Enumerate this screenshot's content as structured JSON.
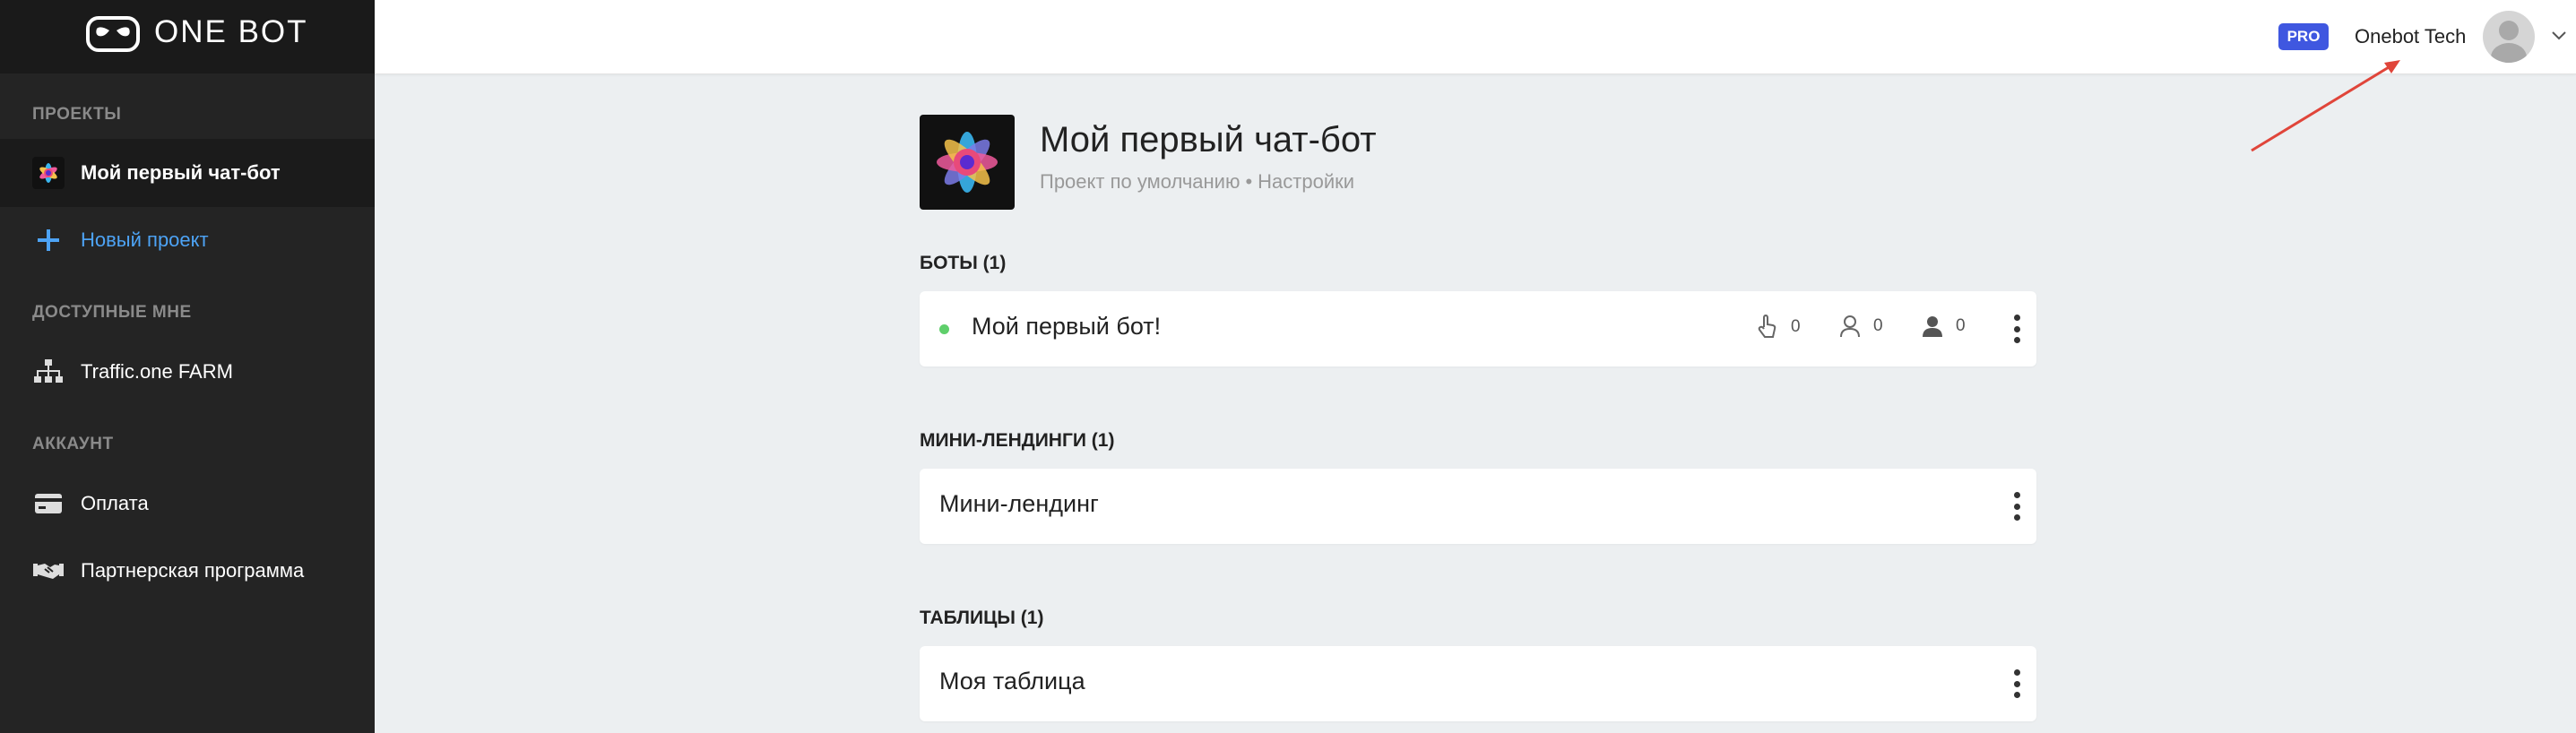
{
  "app": {
    "logo_text": "ONE BOT"
  },
  "sidebar": {
    "sections": [
      {
        "label": "ПРОЕКТЫ"
      },
      {
        "label": "ДОСТУПНЫЕ МНЕ"
      },
      {
        "label": "АККАУНТ"
      }
    ],
    "items": [
      {
        "label": "Мой первый чат-бот",
        "icon": "project-flower-icon",
        "active": true
      },
      {
        "label": "Новый проект",
        "icon": "plus-icon"
      },
      {
        "label": "Traffic.one FARM",
        "icon": "sitemap-icon"
      },
      {
        "label": "Оплата",
        "icon": "credit-card-icon"
      },
      {
        "label": "Партнерская программа",
        "icon": "handshake-icon"
      }
    ]
  },
  "header": {
    "badge": "PRO",
    "user_name": "Onebot Tech",
    "avatar_icon": "user-avatar-icon",
    "dropdown_icon": "chevron-down-icon"
  },
  "project": {
    "title": "Мой первый чат-бот",
    "subtitle_default": "Проект по умолчанию",
    "separator": "•",
    "settings_link": "Настройки"
  },
  "groups": {
    "bots": {
      "label": "БОТЫ (1)",
      "items": [
        {
          "title": "Мой первый бот!",
          "status_color": "#5fcf6b",
          "stats": {
            "clicks": "0",
            "subscribers": "0",
            "users": "0"
          }
        }
      ]
    },
    "landings": {
      "label": "МИНИ-ЛЕНДИНГИ (1)",
      "items": [
        {
          "title": "Мини-лендинг"
        }
      ]
    },
    "tables": {
      "label": "ТАБЛИЦЫ (1)",
      "items": [
        {
          "title": "Моя таблица"
        }
      ]
    }
  },
  "colors": {
    "accent": "#3f57e0",
    "link": "#4da3f5",
    "sidebar_bg": "#242424",
    "annotation_arrow": "#e0453a"
  }
}
